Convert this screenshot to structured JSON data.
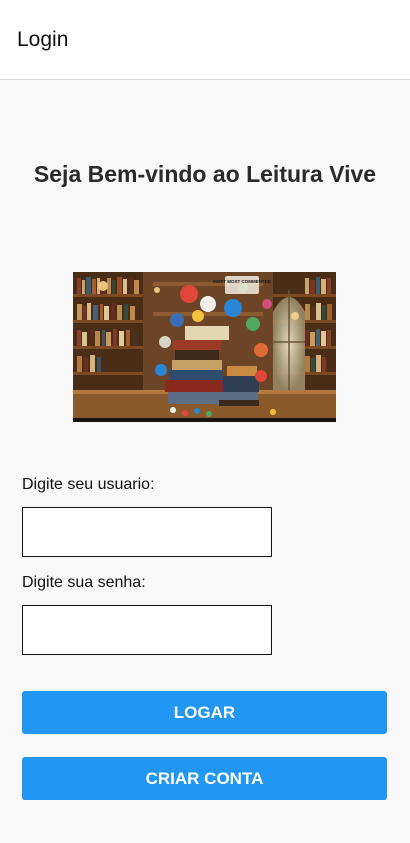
{
  "header": {
    "title": "Login"
  },
  "welcome": {
    "text": "Seja Bem-vindo ao Leitura Vive"
  },
  "hero": {
    "badge_text": "MOST MOST COMMENTED"
  },
  "form": {
    "username_label": "Digite seu usuario:",
    "username_value": "",
    "password_label": "Digite sua senha:",
    "password_value": ""
  },
  "buttons": {
    "login_label": "LOGAR",
    "create_label": "CRIAR CONTA"
  },
  "colors": {
    "primary": "#2196f3",
    "background": "#f8f8f8",
    "header_bg": "#ffffff"
  }
}
